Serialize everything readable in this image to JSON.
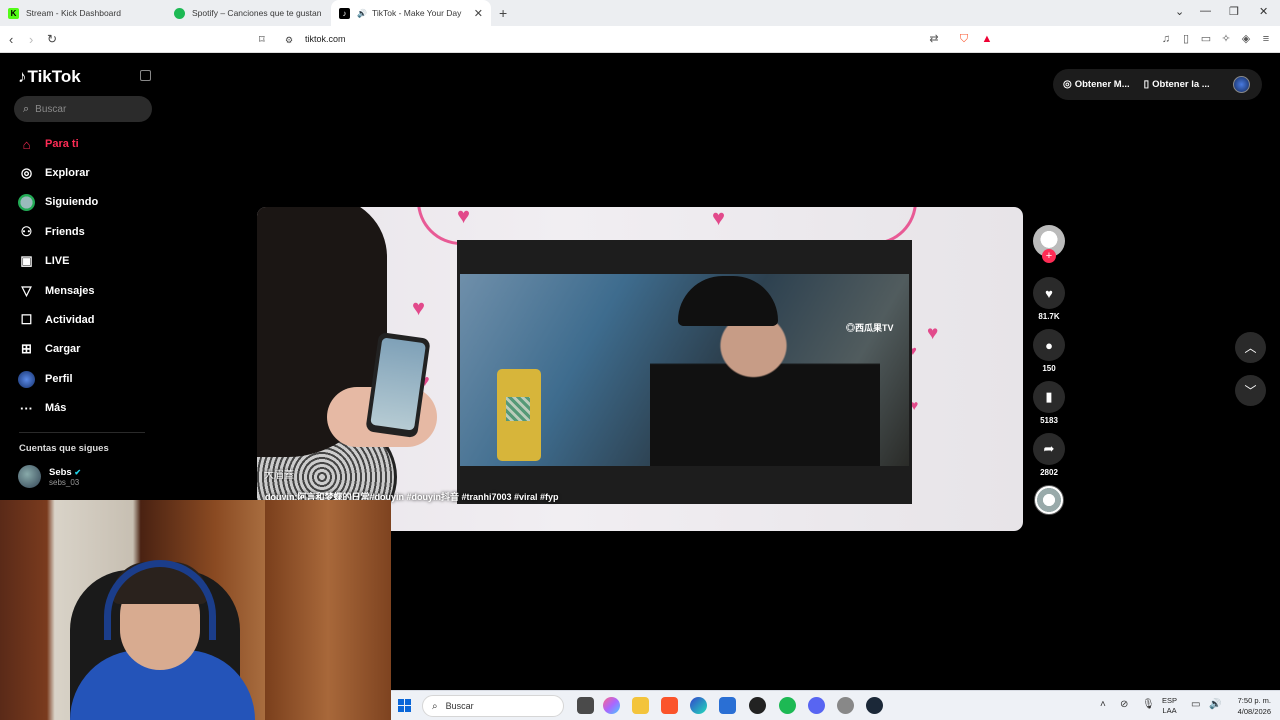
{
  "browser": {
    "tabs": [
      {
        "label": "Stream - Kick Dashboard",
        "active": false,
        "icon": "kick-icon"
      },
      {
        "label": "Spotify – Canciones que te gustan",
        "active": false,
        "icon": "spotify-icon"
      },
      {
        "label": "TikTok - Make Your Day",
        "active": true,
        "icon": "tiktok-icon"
      }
    ],
    "url": "tiktok.com"
  },
  "sidebar": {
    "logo": "TikTok",
    "search_placeholder": "Buscar",
    "nav": [
      {
        "label": "Para ti",
        "icon": "home-icon",
        "active": true
      },
      {
        "label": "Explorar",
        "icon": "compass-icon",
        "active": false
      },
      {
        "label": "Siguiendo",
        "icon": "following-avatar-icon",
        "active": false
      },
      {
        "label": "Friends",
        "icon": "friends-icon",
        "active": false
      },
      {
        "label": "LIVE",
        "icon": "live-tv-icon",
        "active": false
      },
      {
        "label": "Mensajes",
        "icon": "send-icon",
        "active": false
      },
      {
        "label": "Actividad",
        "icon": "activity-icon",
        "active": false
      },
      {
        "label": "Cargar",
        "icon": "upload-icon",
        "active": false
      },
      {
        "label": "Perfil",
        "icon": "profile-icon",
        "active": false
      },
      {
        "label": "Más",
        "icon": "more-icon",
        "active": false
      }
    ],
    "following_title": "Cuentas que sigues",
    "following": [
      {
        "name": "Sebs",
        "username": "sebs_03",
        "verified": true
      }
    ]
  },
  "top_right": {
    "get_coins": "Obtener M...",
    "get_app": "Obtener la ..."
  },
  "video": {
    "author": "大眉蓋",
    "description": "douyin:阿言和梦蝶的日常#douyin #douyin抖音 #tranhi7003 #viral #fyp",
    "watermark": "◎西瓜果TV"
  },
  "actions": {
    "likes": "81.7K",
    "comments": "150",
    "saves": "5183",
    "shares": "2802"
  },
  "taskbar": {
    "search_placeholder": "Buscar",
    "lang_line1": "ESP",
    "lang_line2": "LAA",
    "time": "7:50 p. m.",
    "date": "4/08/2026"
  },
  "colors": {
    "accent": "#fe2c55",
    "background": "#000000"
  }
}
